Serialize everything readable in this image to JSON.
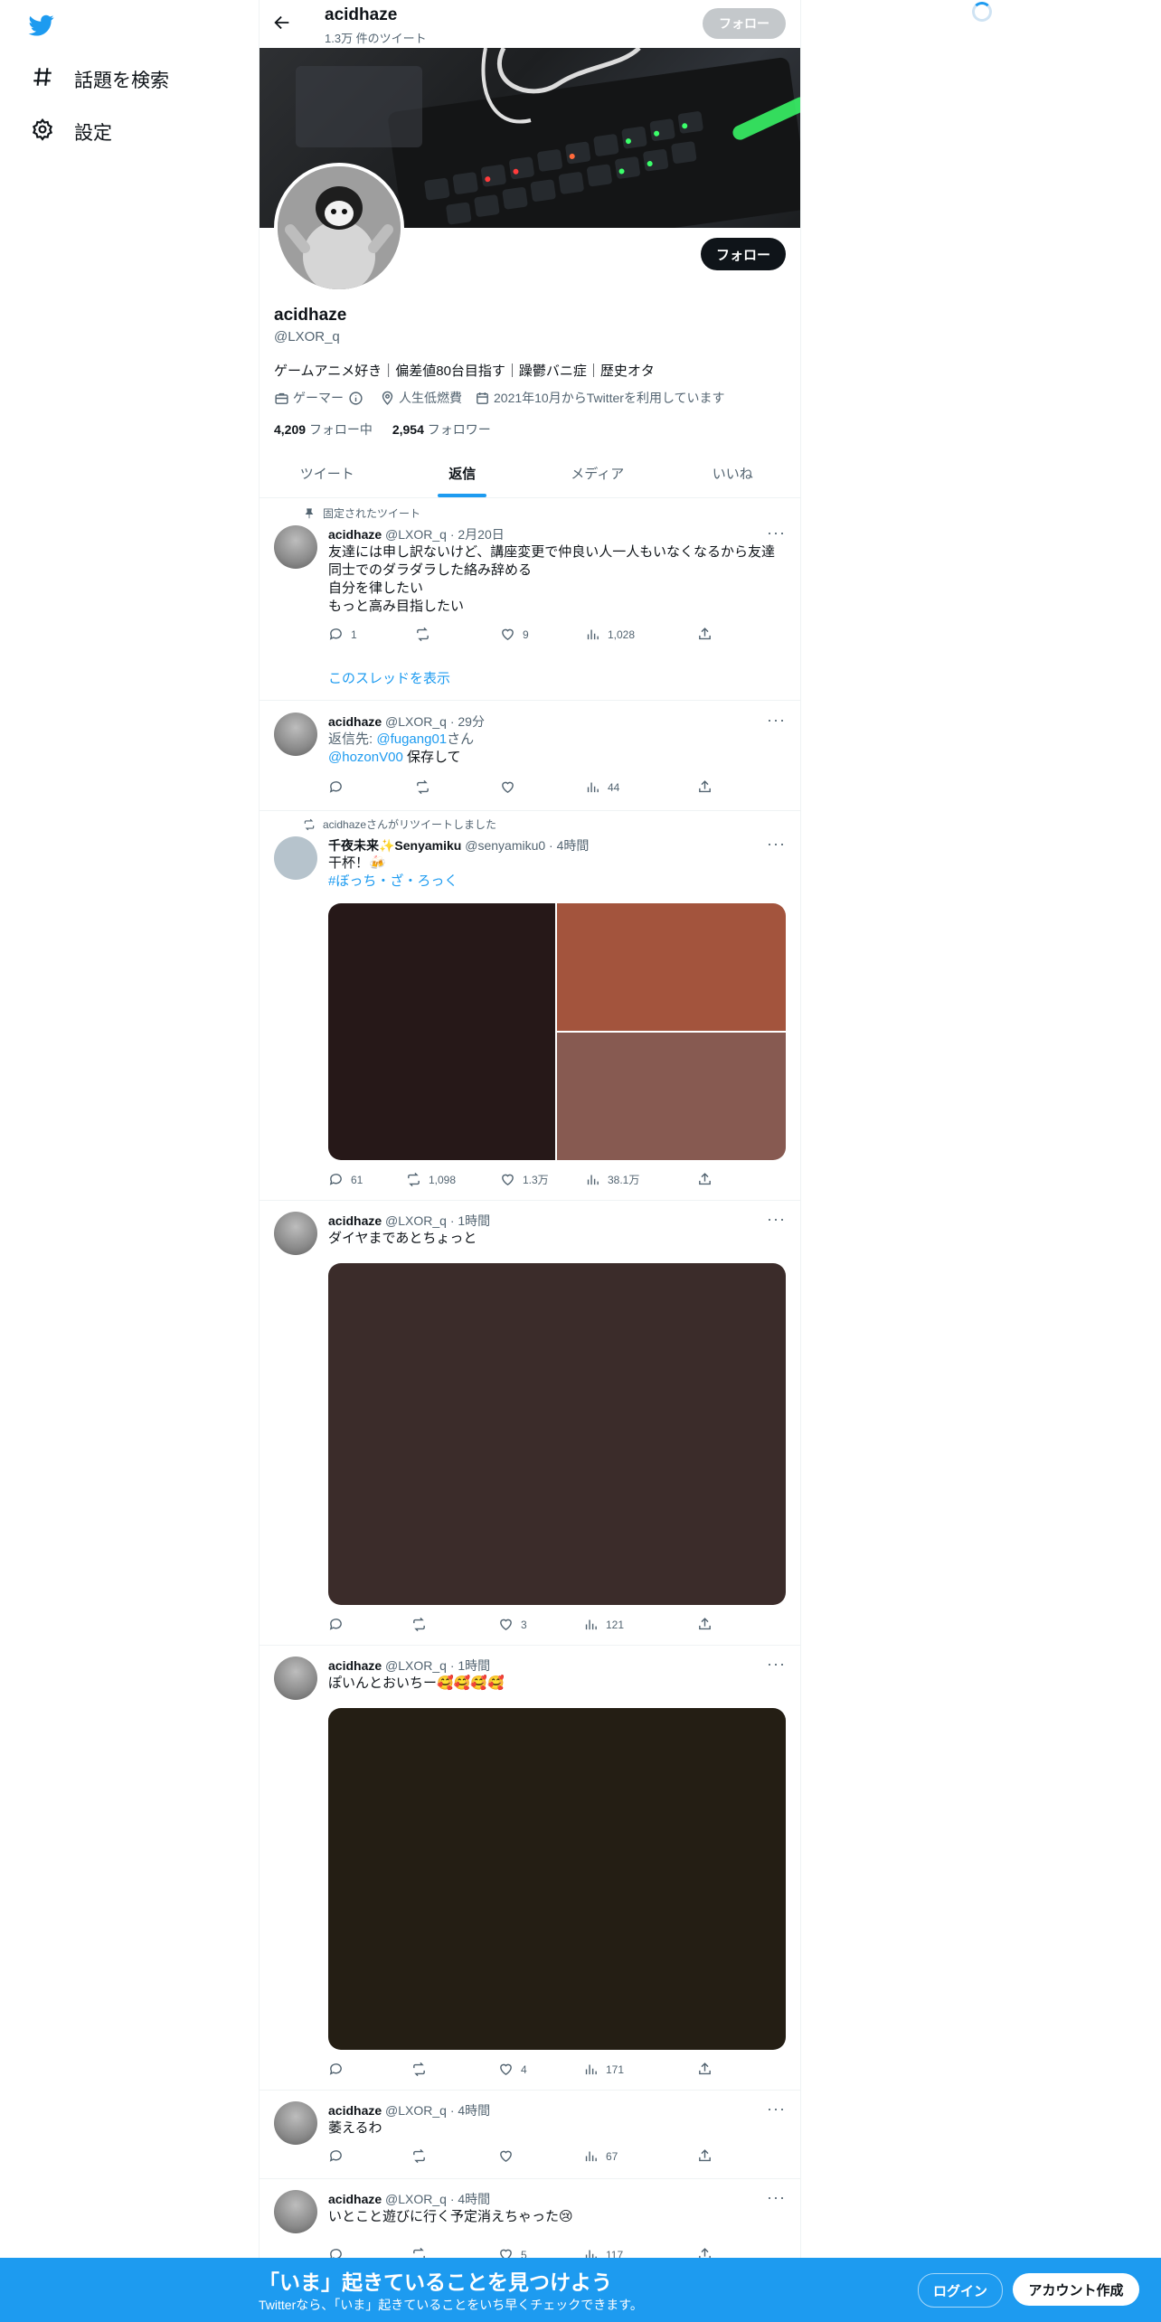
{
  "nav": {
    "explore": "話題を検索",
    "settings": "設定"
  },
  "topbar": {
    "name": "acidhaze",
    "tweet_count": "1.3万 件のツイート",
    "follow": "フォロー"
  },
  "profile": {
    "name": "acidhaze",
    "handle": "@LXOR_q",
    "follow_button": "フォロー",
    "bio": "ゲームアニメ好き｜偏差値80台目指す｜躁鬱バニ症｜歴史オタ",
    "category": "ゲーマー",
    "location": "人生低燃費",
    "joined": "2021年10月からTwitterを利用しています",
    "following_count": "4,209",
    "following_label": "フォロー中",
    "followers_count": "2,954",
    "followers_label": "フォロワー"
  },
  "tabs": [
    "ツイート",
    "返信",
    "メディア",
    "いいね"
  ],
  "tweets": [
    {
      "pinned_label": "固定されたツイート",
      "name": "acidhaze",
      "meta": "@LXOR_q · 2月20日",
      "lines": [
        "友達には申し訳ないけど、講座変更で仲良い人一人もいなくなるから友達",
        "同士でのダラダラした絡み辞める",
        "自分を律したい",
        "もっと高み目指したい"
      ],
      "replies": "1",
      "retweets": "",
      "likes": "9",
      "views": "1,028",
      "thread_link": "このスレッドを表示"
    },
    {
      "name": "acidhaze",
      "meta": "@LXOR_q · 29分",
      "reply_to_prefix": "返信先: ",
      "reply_to": "@fugang01",
      "reply_to_suffix": "さん",
      "mention": "@hozonV00",
      "text": " 保存して",
      "replies": "",
      "retweets": "",
      "likes": "",
      "views": "44"
    },
    {
      "retweet_label": "acidhazeさんがリツイートしました",
      "name": "千夜未来✨Senyamiku",
      "meta": "@senyamiku0 · 4時間",
      "text": "干杯！🍻",
      "hashtag": "#ぼっち・ざ・ろっく",
      "replies": "61",
      "retweets": "1,098",
      "likes": "1.3万",
      "views": "38.1万"
    },
    {
      "name": "acidhaze",
      "meta": "@LXOR_q · 1時間",
      "text": "ダイヤまであとちょっと",
      "replies": "",
      "retweets": "",
      "likes": "3",
      "views": "121"
    },
    {
      "name": "acidhaze",
      "meta": "@LXOR_q · 1時間",
      "text": "ぽいんとおいちー🥰🥰🥰🥰",
      "replies": "",
      "retweets": "",
      "likes": "4",
      "views": "171"
    },
    {
      "name": "acidhaze",
      "meta": "@LXOR_q · 4時間",
      "text": "萎えるわ",
      "replies": "",
      "retweets": "",
      "likes": "",
      "views": "67"
    },
    {
      "name": "acidhaze",
      "meta": "@LXOR_q · 4時間",
      "text": "いとこと遊びに行く予定消えちゃった😢",
      "replies": "",
      "retweets": "",
      "likes": "5",
      "views": "117"
    }
  ],
  "bottom_banner": {
    "title": "「いま」起きていることを見つけよう",
    "subtitle": "Twitterなら、「いま」起きていることをいち早くチェックできます。",
    "login": "ログイン",
    "signup": "アカウント作成"
  },
  "colors": {
    "accent": "#1d9bf0",
    "text": "#0f1419",
    "secondary": "#536471"
  }
}
